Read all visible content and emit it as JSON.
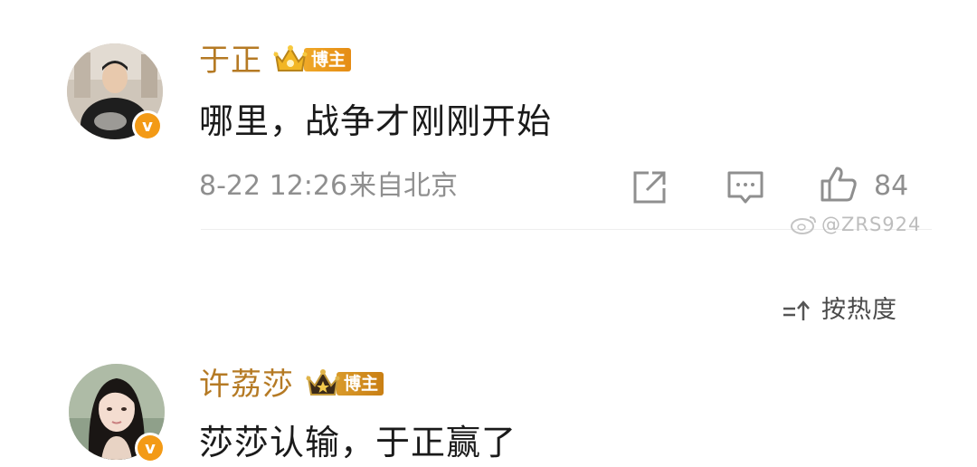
{
  "colors": {
    "username": "#b57a24",
    "badge_gold": "#e6a11c",
    "badge_gold_dark": "#8c5f1f",
    "meta_gray": "#8f8f8f",
    "verified_orange": "#f39a16"
  },
  "comments": [
    {
      "username": "于正",
      "badge_label": "博主",
      "badge_icon": "gold-crown-icon",
      "content": "哪里，战争才刚刚开始",
      "date": "8-22 12:26",
      "location": "来自北京",
      "likes": "84",
      "verified_mark": "v"
    },
    {
      "username": "许荔莎",
      "badge_label": "博主",
      "badge_icon": "dark-crown-icon",
      "content": "莎莎认输，于正赢了",
      "verified_mark": "v"
    }
  ],
  "watermark": "@ZRS924",
  "sort": {
    "icon": "sort-icon",
    "label": "按热度"
  }
}
